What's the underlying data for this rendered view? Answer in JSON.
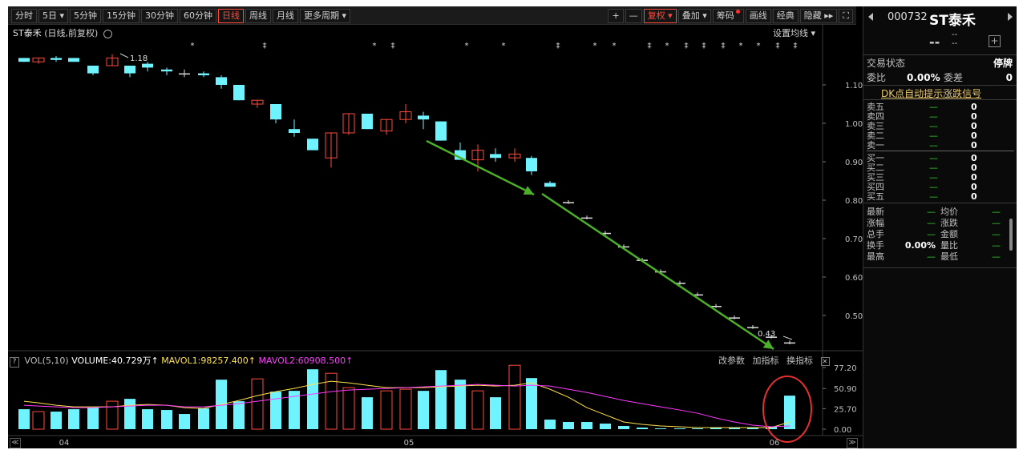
{
  "toolbar": {
    "tabs": [
      "分时",
      "5日 ▾",
      "5分钟",
      "15分钟",
      "30分钟",
      "60分钟",
      "日线",
      "周线",
      "月线",
      "更多周期 ▾"
    ],
    "active_tab": "日线",
    "tools": [
      "+",
      "—",
      "复权 ▾",
      "叠加 ▾",
      "筹码",
      "画线",
      "经典",
      "隐藏 ▸▸",
      "⛶"
    ]
  },
  "chart": {
    "name": "ST泰禾",
    "mode": "(日线,前复权)",
    "set_ma": "设置均线 ▾",
    "price_axis": [
      "1.10",
      "1.00",
      "0.90",
      "0.80",
      "0.70",
      "0.60",
      "0.50"
    ],
    "high_label": "1.18",
    "low_label": "0.43",
    "date_labels": [
      "04",
      "05",
      "06"
    ],
    "colors": {
      "up": "#ff4a3a",
      "down": "#6ff3ff",
      "arrow": "#4caf28",
      "annotation": "#e53030"
    }
  },
  "volume": {
    "help": "?",
    "indicator": "VOL(5,10)",
    "volume_text": "VOLUME:40.729万↑",
    "mavol1_text": "MAVOL1:98257.400↑",
    "mavol2_text": "MAVOL2:60908.500↑",
    "tools": [
      "改参数",
      "加指标",
      "换指标"
    ],
    "close": "✕",
    "axis": [
      "77.20",
      "50.90",
      "25.70",
      "0.00"
    ]
  },
  "scroll": {
    "left": "≪",
    "right": "≫"
  },
  "quote": {
    "code": "000732",
    "name": "ST泰禾",
    "price": "--",
    "change": "--",
    "change_pct": "--",
    "plus": "+",
    "status_label": "交易状态",
    "status_value": "停牌",
    "weibi_label": "委比",
    "weibi_value": "0.00%",
    "weicha_label": "委差",
    "weicha_value": "0",
    "dk_link": "DK点自动提示涨跌信号",
    "sell": [
      {
        "label": "卖五",
        "price": "—",
        "vol": "0"
      },
      {
        "label": "卖四",
        "price": "—",
        "vol": "0"
      },
      {
        "label": "卖三",
        "price": "—",
        "vol": "0"
      },
      {
        "label": "卖二",
        "price": "—",
        "vol": "0"
      },
      {
        "label": "卖一",
        "price": "—",
        "vol": "0"
      }
    ],
    "buy": [
      {
        "label": "买一",
        "price": "—",
        "vol": "0"
      },
      {
        "label": "买二",
        "price": "—",
        "vol": "0"
      },
      {
        "label": "买三",
        "price": "—",
        "vol": "0"
      },
      {
        "label": "买四",
        "price": "—",
        "vol": "0"
      },
      {
        "label": "买五",
        "price": "—",
        "vol": "0"
      }
    ],
    "stats": [
      {
        "label": "最新",
        "value": "—",
        "label2": "均价",
        "value2": "—"
      },
      {
        "label": "涨幅",
        "value": "—",
        "label2": "涨跌",
        "value2": "—"
      },
      {
        "label": "总手",
        "value": "—",
        "label2": "金额",
        "value2": "—"
      },
      {
        "label": "换手",
        "value": "0.00%",
        "label2": "量比",
        "value2": "—"
      },
      {
        "label": "最高",
        "value": "—",
        "label2": "最低",
        "value2": "—"
      }
    ]
  }
}
